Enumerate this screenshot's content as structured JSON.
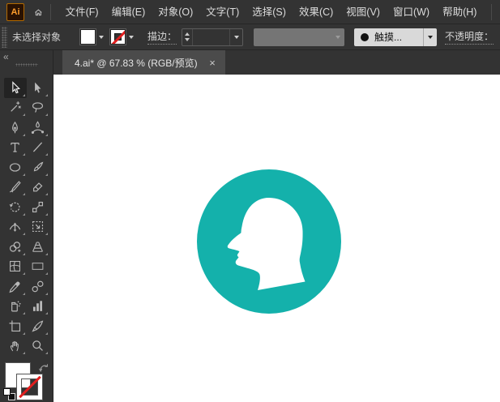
{
  "app": {
    "logo_text": "Ai"
  },
  "menubar": {
    "items": [
      "文件(F)",
      "编辑(E)",
      "对象(O)",
      "文字(T)",
      "选择(S)",
      "效果(C)",
      "视图(V)",
      "窗口(W)",
      "帮助(H)"
    ]
  },
  "options_bar": {
    "selection_status": "未选择对象",
    "fill_swatch": "white",
    "stroke_swatch": "none",
    "stroke_label": "描边：",
    "stroke_weight_value": "",
    "variable_width_profile": "",
    "brush_label": "触摸...",
    "opacity_label": "不透明度："
  },
  "tab": {
    "title": "4.ai* @ 67.83 % (RGB/预览)",
    "close": "×"
  },
  "panel": {
    "collapse": "«"
  },
  "tools": {
    "active": "selection",
    "rows": [
      [
        "selection",
        "direct-selection"
      ],
      [
        "magic-wand",
        "lasso"
      ],
      [
        "pen",
        "curvature"
      ],
      [
        "type",
        "line-segment"
      ],
      [
        "ellipse",
        "paintbrush"
      ],
      [
        "shaper",
        "eraser"
      ],
      [
        "rotate",
        "scale"
      ],
      [
        "width",
        "free-transform"
      ],
      [
        "shape-builder",
        "perspective-grid"
      ],
      [
        "mesh",
        "gradient"
      ],
      [
        "eyedropper",
        "blend"
      ],
      [
        "symbol-sprayer",
        "column-graph"
      ],
      [
        "artboard",
        "slice"
      ],
      [
        "hand",
        "zoom"
      ]
    ]
  },
  "swatch_proxy": {
    "fill": "#ffffff",
    "stroke": "none"
  },
  "artwork": {
    "name": "head-profile-badge",
    "circle_color": "#14b1ab",
    "head_color": "#ffffff"
  },
  "colors": {
    "chrome": "#333333",
    "tab_active": "#4b4b4b",
    "canvas": "#ffffff",
    "slash_red": "#e01e1e",
    "logo_orange": "#ff9e2c"
  }
}
